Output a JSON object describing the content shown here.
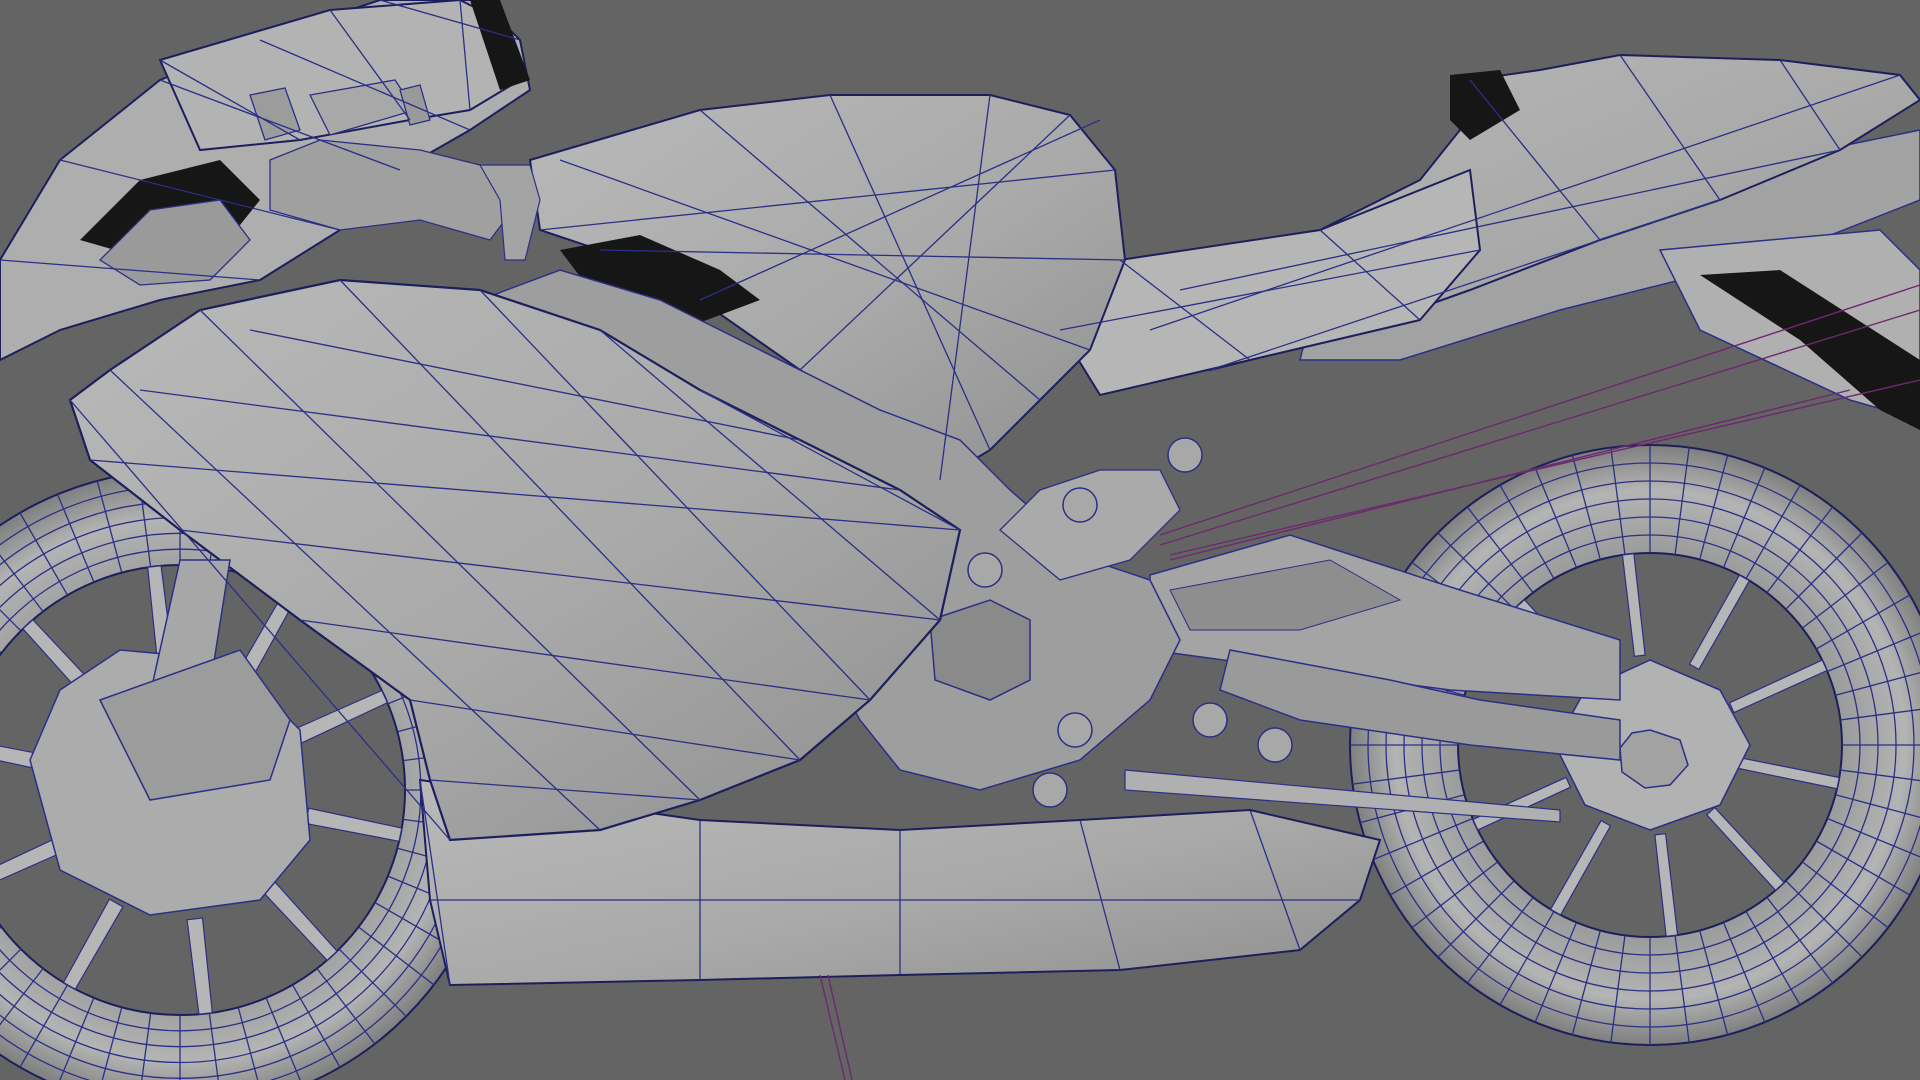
{
  "viewport": {
    "background": "#646464",
    "model_fill": "#a6a6a6",
    "model_fill_light": "#b8b8b8",
    "model_fill_dark": "#8c8c8c",
    "wireframe_color": "#2b2f86",
    "curve_color": "#6b2a6e",
    "display_mode": "wireframe-on-shaded"
  }
}
